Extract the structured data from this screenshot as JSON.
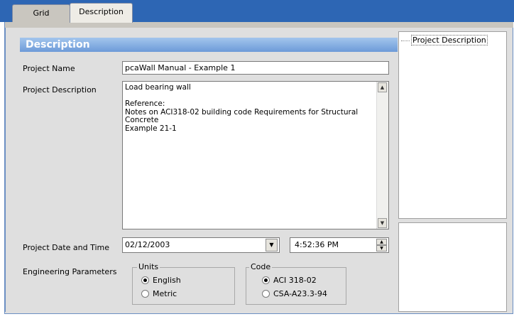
{
  "tabs": [
    {
      "label": "Grid"
    },
    {
      "label": "Description"
    }
  ],
  "section": {
    "title": "Description"
  },
  "fields": {
    "project_name": {
      "label": "Project Name",
      "value": "pcaWall Manual - Example 1"
    },
    "project_description": {
      "label": "Project Description",
      "value": "Load bearing wall\n\nReference:\nNotes on ACI318-02 building code Requirements for Structural Concrete\nExample 21-1"
    },
    "project_date_time": {
      "label": "Project Date and Time",
      "date": "02/12/2003",
      "time": "4:52:36 PM"
    },
    "engineering_parameters": {
      "label": "Engineering Parameters"
    }
  },
  "units": {
    "title": "Units",
    "options": [
      {
        "label": "English",
        "selected": true
      },
      {
        "label": "Metric",
        "selected": false
      }
    ]
  },
  "code": {
    "title": "Code",
    "options": [
      {
        "label": "ACI 318-02",
        "selected": true
      },
      {
        "label": "CSA-A23.3-94",
        "selected": false
      }
    ]
  },
  "tree": {
    "items": [
      {
        "label": "Project Description"
      }
    ]
  },
  "colors": {
    "tabbar": "#2d66b4",
    "header_gradient_top": "#a3c5ed",
    "header_gradient_bottom": "#6d9bd8",
    "panel_bg": "#dfdfdf"
  }
}
